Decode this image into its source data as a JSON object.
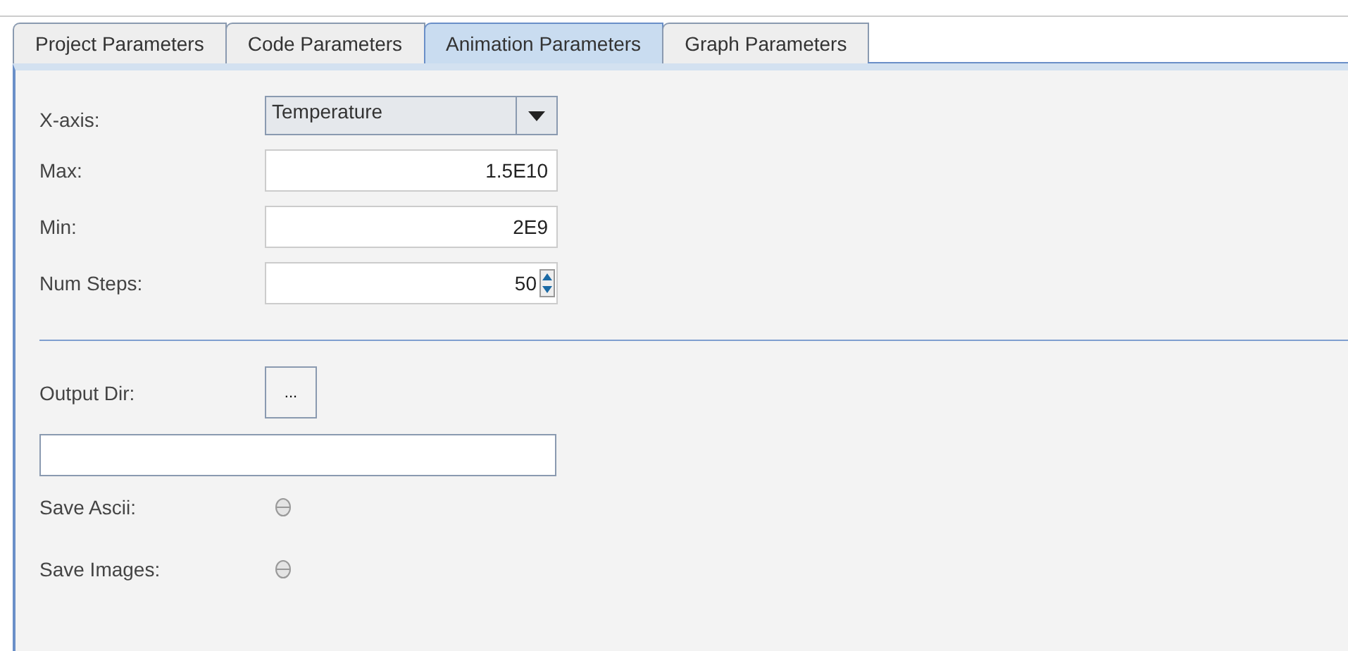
{
  "tabs": [
    {
      "label": "Project Parameters",
      "selected": false
    },
    {
      "label": "Code Parameters",
      "selected": false
    },
    {
      "label": "Animation Parameters",
      "selected": true
    },
    {
      "label": "Graph Parameters",
      "selected": false
    }
  ],
  "x_axis": {
    "label": "X-axis:",
    "value": "Temperature"
  },
  "max": {
    "label": "Max:",
    "value": "1.5E10"
  },
  "min": {
    "label": "Min:",
    "value": "2E9"
  },
  "num_steps": {
    "label": "Num Steps:",
    "value": "50"
  },
  "output_dir": {
    "label": "Output Dir:",
    "button": "..."
  },
  "toggles": [
    {
      "label": "Save Ascii:",
      "checked": false
    },
    {
      "label": "Save Images:",
      "checked": false
    }
  ]
}
